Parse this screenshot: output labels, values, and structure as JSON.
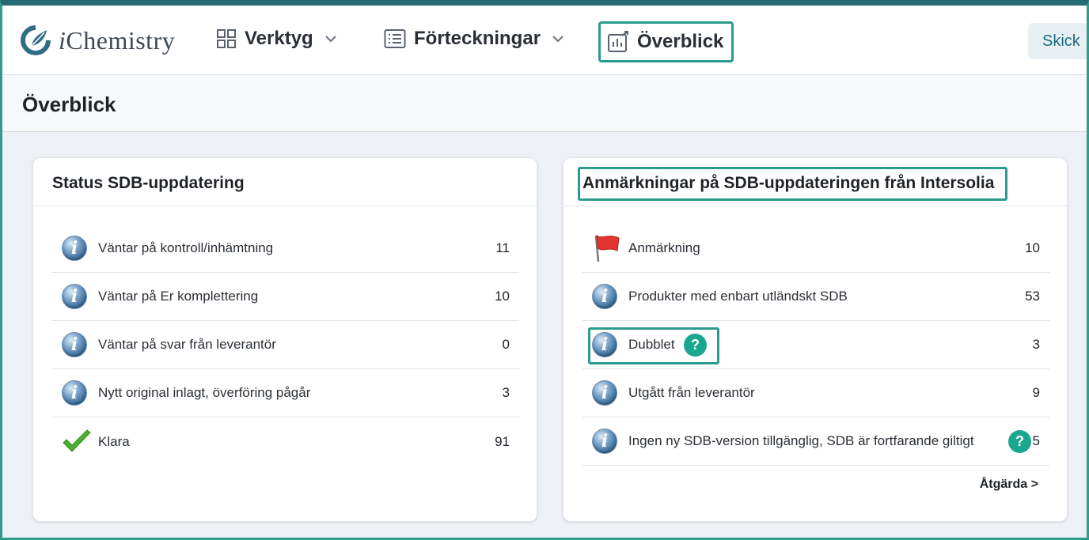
{
  "header": {
    "logo_text_i": "i",
    "logo_text_rest": "Chemistry",
    "nav": [
      {
        "label": "Verktyg",
        "icon": "grid-icon"
      },
      {
        "label": "Förteckningar",
        "icon": "list-icon"
      },
      {
        "label": "Överblick",
        "icon": "chart-icon"
      }
    ],
    "action_button": "Skick"
  },
  "page": {
    "title": "Överblick"
  },
  "left_card": {
    "title": "Status SDB-uppdatering",
    "rows": [
      {
        "icon": "info-icon",
        "label": "Väntar på kontroll/inhämtning",
        "value": "11"
      },
      {
        "icon": "info-icon",
        "label": "Väntar på Er komplettering",
        "value": "10"
      },
      {
        "icon": "info-icon",
        "label": "Väntar på svar från leverantör",
        "value": "0"
      },
      {
        "icon": "info-icon",
        "label": "Nytt original inlagt, överföring pågår",
        "value": "3"
      },
      {
        "icon": "check-icon",
        "label": "Klara",
        "value": "91"
      }
    ]
  },
  "right_card": {
    "title": "Anmärkningar på SDB-uppdateringen från Intersolia",
    "rows": [
      {
        "icon": "flag-icon",
        "label": "Anmärkning",
        "value": "10"
      },
      {
        "icon": "info-icon",
        "label": "Produkter med enbart utländskt SDB",
        "value": "53"
      },
      {
        "icon": "info-icon",
        "label": "Dubblet",
        "value": "3"
      },
      {
        "icon": "info-icon",
        "label": "Utgått från leverantör",
        "value": "9"
      },
      {
        "icon": "info-icon",
        "label": "Ingen ny SDB-version tillgänglig, SDB är fortfarande giltigt",
        "value": "5"
      }
    ],
    "action_link": "Åtgärda >",
    "help_symbol": "?"
  },
  "colors": {
    "accent_teal": "#2a9c8e",
    "help_badge": "#1aa68f",
    "frame_top": "#246a73"
  }
}
